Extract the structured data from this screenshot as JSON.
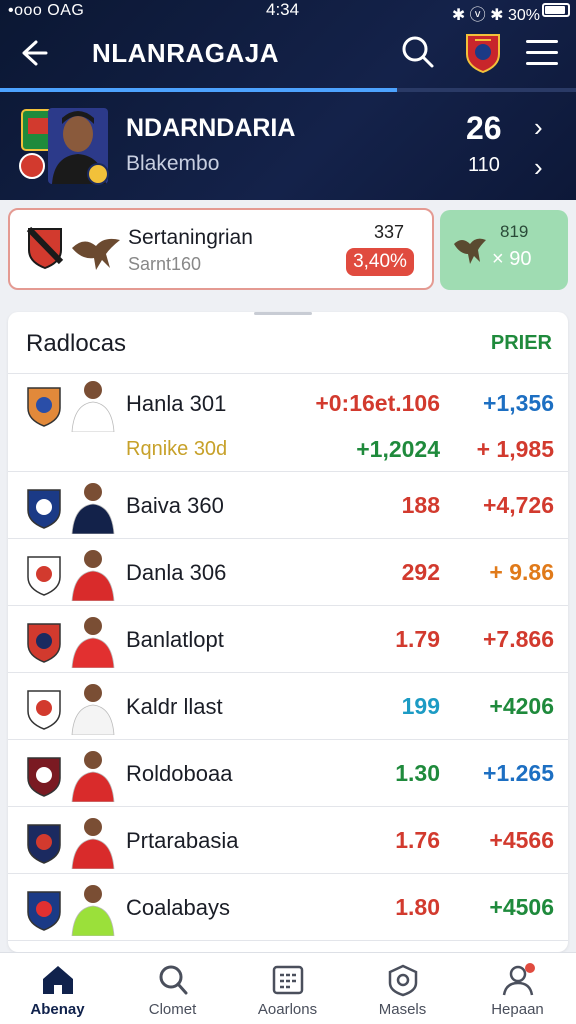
{
  "status_bar": {
    "left": "•ooo OAG",
    "time": "4:34",
    "right": "✱ ⓥ ✱ 30%"
  },
  "app_bar": {
    "title": "NLANRAGAJA"
  },
  "progress": {
    "value": 0.69
  },
  "profile": {
    "name": "NDARNDARIA",
    "subtitle": "Blakembo",
    "primary_stat": "26",
    "secondary_stat": "110"
  },
  "promo": {
    "title": "Sertaningrian",
    "subtitle": "Sarnt160",
    "value": "337",
    "badge": "3,40%"
  },
  "promo_secondary": {
    "top": "819",
    "bottom": "× 90"
  },
  "panel": {
    "title": "Radlocas",
    "link": "PRIER",
    "rows": [
      {
        "name": "Hanla 301",
        "sub_name": "Rqnike 30d",
        "value1": "+0:16et.106",
        "value2": "+1,356",
        "sub_value1": "+1,2024",
        "sub_value2": "+ 1,985",
        "value1_color": "#d23a2e",
        "value2_color": "#1d6fc2",
        "sub_value1_color": "#1f8a3c",
        "sub_value2_color": "#d23a2e",
        "crest_colors": [
          "#e2893a",
          "#2a4ea8"
        ],
        "kit_color": "#ffffff"
      },
      {
        "name": "Baiva 360",
        "value1": "188",
        "value2": "+4,726",
        "value1_color": "#d23a2e",
        "value2_color": "#d23a2e",
        "crest_colors": [
          "#1b3a86",
          "#ffffff"
        ],
        "kit_color": "#13224a"
      },
      {
        "name": "Danla 306",
        "value1": "292",
        "value2": "+ 9.86",
        "value1_color": "#d23a2e",
        "value2_color": "#e07a1a",
        "crest_colors": [
          "#ffffff",
          "#d23a2e"
        ],
        "kit_color": "#d92b2b"
      },
      {
        "name": "Banlatlopt",
        "value1": "1.79",
        "value2": "+7.866",
        "value1_color": "#d23a2e",
        "value2_color": "#d23a2e",
        "crest_colors": [
          "#d23a2e",
          "#1b2a60"
        ],
        "kit_color": "#e23030"
      },
      {
        "name": "Kaldr llast",
        "value1": "199",
        "value2": "+4206",
        "value1_color": "#1c9bc4",
        "value2_color": "#1f8a3c",
        "crest_colors": [
          "#ffffff",
          "#d23a2e"
        ],
        "kit_color": "#f4f4f4"
      },
      {
        "name": "Roldoboaa",
        "value1": "1.30",
        "value2": "+1.265",
        "value1_color": "#1f8a3c",
        "value2_color": "#1d6fc2",
        "crest_colors": [
          "#7a1a22",
          "#ffffff"
        ],
        "kit_color": "#d92b2b"
      },
      {
        "name": "Prtarabasia",
        "value1": "1.76",
        "value2": "+4566",
        "value1_color": "#d23a2e",
        "value2_color": "#d23a2e",
        "crest_colors": [
          "#1b2a60",
          "#d23a2e"
        ],
        "kit_color": "#d92b2b"
      },
      {
        "name": "Coalabays",
        "value1": "1.80",
        "value2": "+4506",
        "value1_color": "#d23a2e",
        "value2_color": "#1f8a3c",
        "crest_colors": [
          "#1b3a86",
          "#e23030"
        ],
        "kit_color": "#9be03a"
      }
    ]
  },
  "bottom_nav": [
    {
      "label": "Abenay",
      "icon": "home-icon",
      "active": true
    },
    {
      "label": "Clomet",
      "icon": "search-icon",
      "active": false
    },
    {
      "label": "Aoarlons",
      "icon": "calendar-icon",
      "active": false
    },
    {
      "label": "Masels",
      "icon": "shield-icon",
      "active": false
    },
    {
      "label": "Hepaan",
      "icon": "user-icon",
      "active": false
    }
  ],
  "colors": {
    "header_bg": "#0b1733",
    "accent": "#4da3ff",
    "positive": "#1f8a3c",
    "negative": "#d23a2e",
    "promo_badge": "#e04b3f"
  }
}
